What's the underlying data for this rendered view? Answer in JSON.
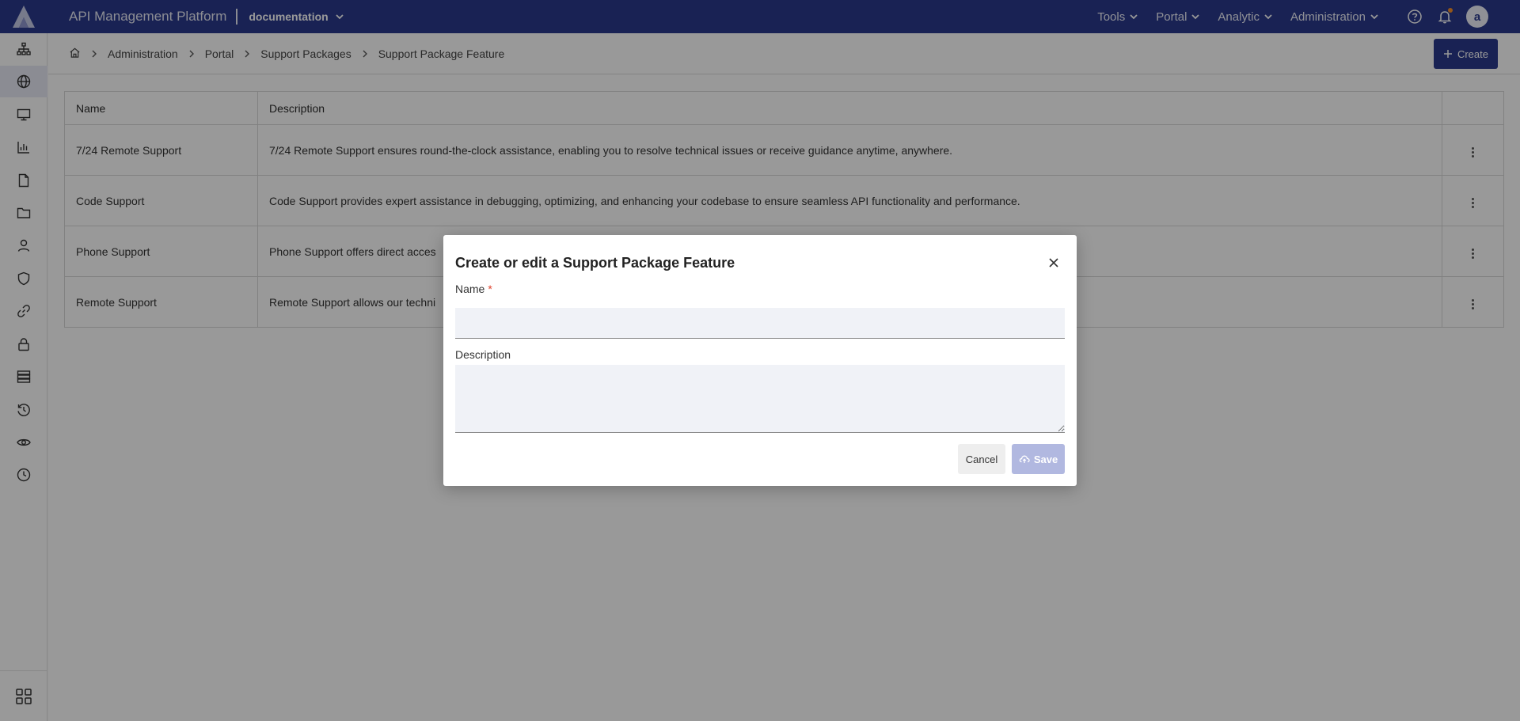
{
  "header": {
    "app_title": "API Management Platform",
    "workspace": "documentation",
    "nav": [
      {
        "label": "Tools"
      },
      {
        "label": "Portal"
      },
      {
        "label": "Analytic"
      },
      {
        "label": "Administration"
      }
    ],
    "avatar_initial": "a"
  },
  "sidebar": {
    "items": [
      {
        "icon": "org-chart-icon"
      },
      {
        "icon": "globe-icon",
        "active": true
      },
      {
        "icon": "monitor-icon"
      },
      {
        "icon": "bar-chart-icon"
      },
      {
        "icon": "file-icon"
      },
      {
        "icon": "folder-icon"
      },
      {
        "icon": "user-icon"
      },
      {
        "icon": "shield-icon"
      },
      {
        "icon": "link-icon"
      },
      {
        "icon": "lock-icon"
      },
      {
        "icon": "server-icon"
      },
      {
        "icon": "history-icon"
      },
      {
        "icon": "eye-icon"
      },
      {
        "icon": "clock-icon"
      }
    ],
    "bottom_icon": "apps-grid-icon"
  },
  "breadcrumb": {
    "items": [
      "Administration",
      "Portal",
      "Support Packages",
      "Support Package Feature"
    ]
  },
  "toolbar": {
    "create_label": "Create"
  },
  "table": {
    "headers": {
      "name": "Name",
      "description": "Description"
    },
    "rows": [
      {
        "name": "7/24 Remote Support",
        "description": "7/24 Remote Support ensures round-the-clock assistance, enabling you to resolve technical issues or receive guidance anytime, anywhere."
      },
      {
        "name": "Code Support",
        "description": "Code Support provides expert assistance in debugging, optimizing, and enhancing your codebase to ensure seamless API functionality and performance."
      },
      {
        "name": "Phone Support",
        "description": "Phone Support offers direct acces"
      },
      {
        "name": "Remote Support",
        "description": "Remote Support allows our techni"
      }
    ]
  },
  "modal": {
    "title": "Create or edit a Support Package Feature",
    "name_label": "Name",
    "required_mark": "*",
    "name_value": "",
    "description_label": "Description",
    "description_value": "",
    "cancel_label": "Cancel",
    "save_label": "Save"
  },
  "colors": {
    "brand": "#2a3a8c",
    "save_disabled": "#b1b8e0",
    "notification_dot": "#f5902b",
    "required": "#e0412b"
  }
}
